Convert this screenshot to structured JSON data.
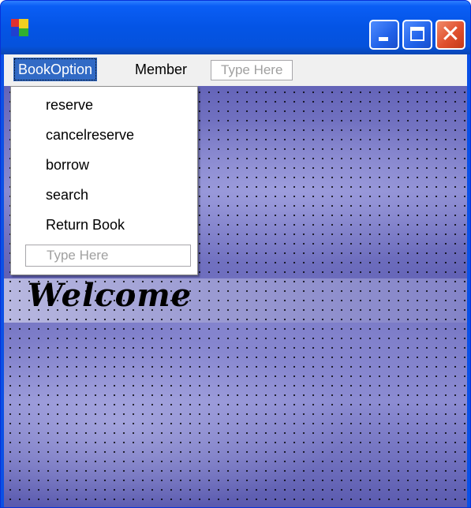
{
  "window": {
    "controls": {
      "minimize_icon": "minimize-icon",
      "maximize_icon": "maximize-icon",
      "close_icon": "close-icon",
      "close_glyph": "✕"
    }
  },
  "menubar": {
    "items": [
      {
        "label": "BookOption"
      },
      {
        "label": "Member"
      }
    ],
    "type_here": "Type Here"
  },
  "dropdown": {
    "items": [
      {
        "label": "reserve"
      },
      {
        "label": "cancelreserve"
      },
      {
        "label": "borrow"
      },
      {
        "label": "search"
      },
      {
        "label": "Return Book"
      }
    ],
    "type_here": "Type Here"
  },
  "content": {
    "welcome": "Welcome"
  },
  "colors": {
    "titlebar": "#0454e5",
    "menu_highlight": "#316ac5",
    "close_button": "#e0502e",
    "background_tint": "#6a6ab8"
  }
}
